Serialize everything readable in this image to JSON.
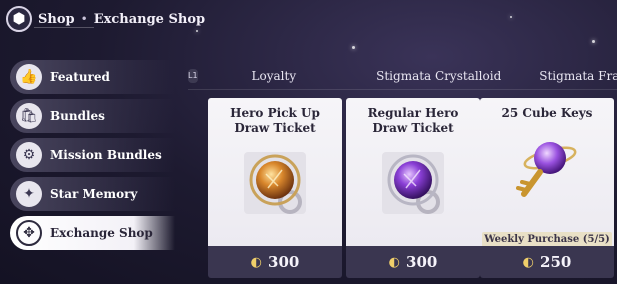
{
  "header": {
    "logo_icon": "game-logo-icon",
    "title": "Shop",
    "separator": "•",
    "subtitle": "Exchange Shop"
  },
  "sidebar": {
    "items": [
      {
        "label": "Featured",
        "icon": "thumbs-up-icon",
        "glyph": "👍",
        "active": false
      },
      {
        "label": "Bundles",
        "icon": "bundle-bag-icon",
        "glyph": "🛍",
        "active": false
      },
      {
        "label": "Mission Bundles",
        "icon": "mission-gear-icon",
        "glyph": "⚙",
        "active": false
      },
      {
        "label": "Star Memory",
        "icon": "star-memory-icon",
        "glyph": "✦",
        "active": false
      },
      {
        "label": "Exchange Shop",
        "icon": "exchange-icon",
        "glyph": "✥",
        "active": true
      }
    ]
  },
  "tabs": {
    "l1_badge": "L1",
    "items": [
      "Loyalty",
      "Stigmata Crystalloid",
      "Stigmata Fragmen"
    ]
  },
  "cards": [
    {
      "title": "Hero Pick Up Draw Ticket",
      "icon": "orange-orb-ticket-icon",
      "price": "300",
      "currency_icon": "crystal-coin-icon"
    },
    {
      "title": "Regular Hero Draw Ticket",
      "icon": "purple-orb-ticket-icon",
      "price": "300",
      "currency_icon": "crystal-coin-icon"
    },
    {
      "title": "25 Cube Keys",
      "icon": "cube-key-icon",
      "price": "250",
      "currency_icon": "crystal-coin-icon",
      "limit": "Weekly Purchase (5/5)"
    }
  ],
  "colors": {
    "background": "#1d1a30",
    "card": "#f6f5f8",
    "price_bar": "#3a3650",
    "coin": "#f0cf6a"
  }
}
